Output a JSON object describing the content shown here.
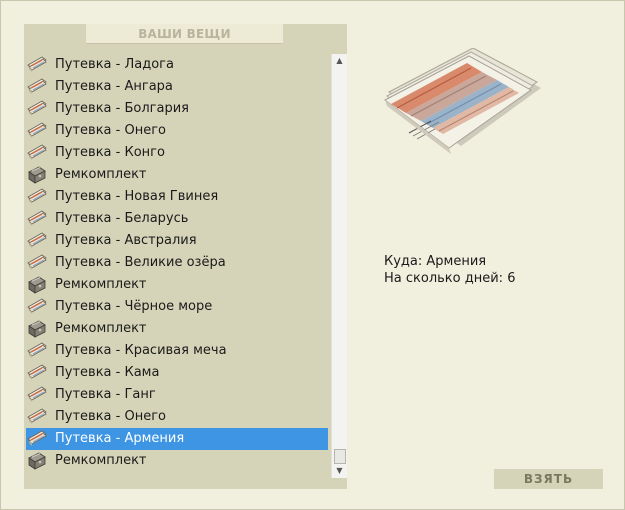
{
  "panel": {
    "title": "ВАШИ ВЕЩИ",
    "items": [
      {
        "label": "Путевка - Ладога",
        "icon": "ticket-icon",
        "selected": false
      },
      {
        "label": "Путевка - Ангара",
        "icon": "ticket-icon",
        "selected": false
      },
      {
        "label": "Путевка - Болгария",
        "icon": "ticket-icon",
        "selected": false
      },
      {
        "label": "Путевка - Онего",
        "icon": "ticket-icon",
        "selected": false
      },
      {
        "label": "Путевка - Конго",
        "icon": "ticket-icon",
        "selected": false
      },
      {
        "label": "Ремкомплект",
        "icon": "repair-kit-icon",
        "selected": false
      },
      {
        "label": "Путевка - Новая Гвинея",
        "icon": "ticket-icon",
        "selected": false
      },
      {
        "label": "Путевка - Беларусь",
        "icon": "ticket-icon",
        "selected": false
      },
      {
        "label": "Путевка - Австралия",
        "icon": "ticket-icon",
        "selected": false
      },
      {
        "label": "Путевка - Великие озёра",
        "icon": "ticket-icon",
        "selected": false
      },
      {
        "label": "Ремкомплект",
        "icon": "repair-kit-icon",
        "selected": false
      },
      {
        "label": "Путевка - Чёрное море",
        "icon": "ticket-icon",
        "selected": false
      },
      {
        "label": "Ремкомплект",
        "icon": "repair-kit-icon",
        "selected": false
      },
      {
        "label": "Путевка - Красивая меча",
        "icon": "ticket-icon",
        "selected": false
      },
      {
        "label": "Путевка - Кама",
        "icon": "ticket-icon",
        "selected": false
      },
      {
        "label": "Путевка - Ганг",
        "icon": "ticket-icon",
        "selected": false
      },
      {
        "label": "Путевка - Онего",
        "icon": "ticket-icon",
        "selected": false
      },
      {
        "label": "Путевка - Армения",
        "icon": "ticket-icon",
        "selected": true
      },
      {
        "label": "Ремкомплект",
        "icon": "repair-kit-icon",
        "selected": false
      }
    ]
  },
  "details": {
    "image_icon": "ticket-bundle-icon",
    "destination_label": "Куда:",
    "destination_value": "Армения",
    "days_label": "На сколько дней:",
    "days_value": "6"
  },
  "take_button": {
    "label": "ВЗЯТЬ"
  },
  "colors": {
    "background": "#f1efde",
    "panel": "#d6d4b8",
    "selection": "#3d95e4",
    "button_text": "#7a7860"
  }
}
